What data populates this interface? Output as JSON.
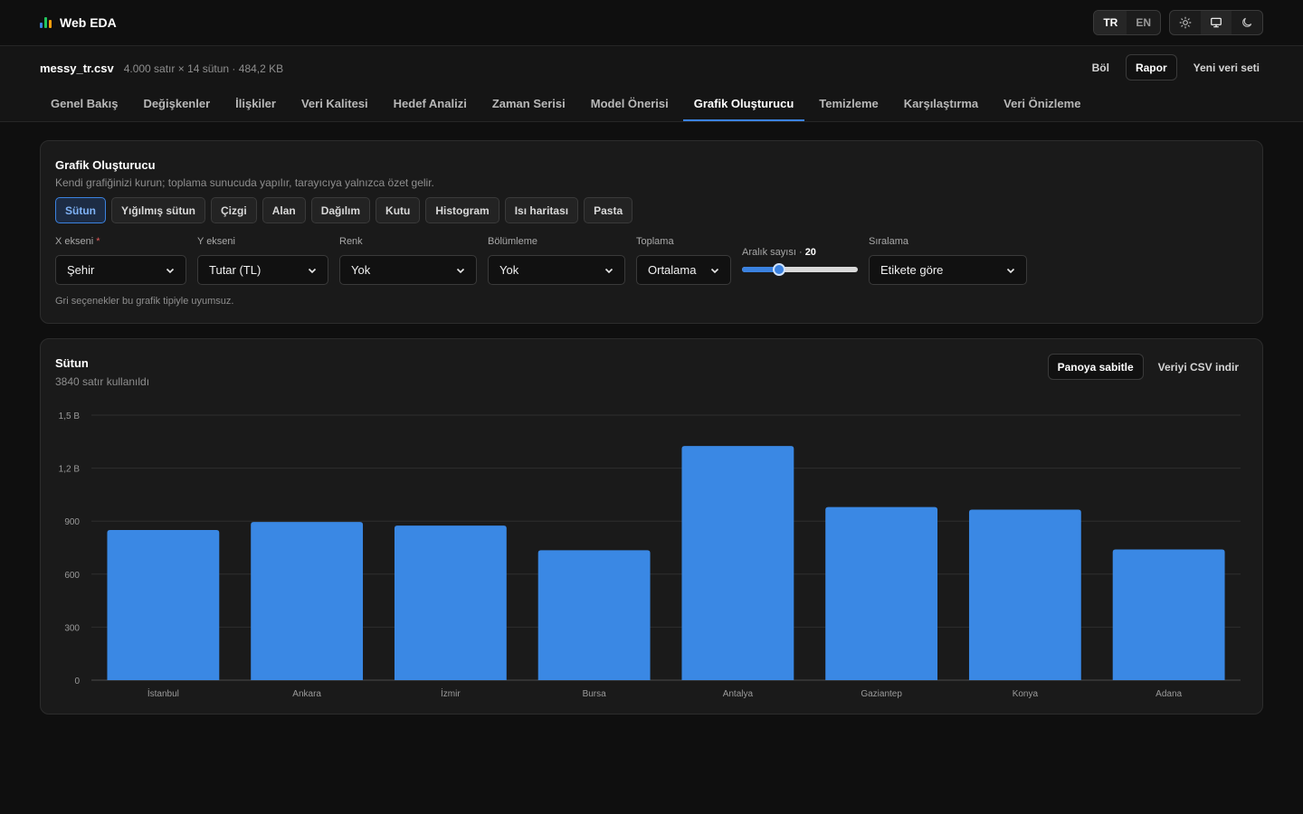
{
  "app": {
    "title": "Web EDA"
  },
  "lang": {
    "tr": "TR",
    "en": "EN",
    "active": "TR"
  },
  "file": {
    "name": "messy_tr.csv",
    "meta": "4.000 satır × 14 sütun · 484,2 KB",
    "actions": {
      "split": "Böl",
      "report": "Rapor",
      "new_dataset": "Yeni veri seti"
    }
  },
  "tabs": [
    {
      "label": "Genel Bakış"
    },
    {
      "label": "Değişkenler"
    },
    {
      "label": "İlişkiler"
    },
    {
      "label": "Veri Kalitesi"
    },
    {
      "label": "Hedef Analizi"
    },
    {
      "label": "Zaman Serisi"
    },
    {
      "label": "Model Önerisi"
    },
    {
      "label": "Grafik Oluşturucu",
      "active": true
    },
    {
      "label": "Temizleme"
    },
    {
      "label": "Karşılaştırma"
    },
    {
      "label": "Veri Önizleme"
    }
  ],
  "builder": {
    "title": "Grafik Oluşturucu",
    "subtitle": "Kendi grafiğinizi kurun; toplama sunucuda yapılır, tarayıcıya yalnızca özet gelir.",
    "types": [
      "Sütun",
      "Yığılmış sütun",
      "Çizgi",
      "Alan",
      "Dağılım",
      "Kutu",
      "Histogram",
      "Isı haritası",
      "Pasta"
    ],
    "active_type": "Sütun",
    "controls": {
      "x_axis": {
        "label": "X ekseni",
        "required": "*",
        "value": "Şehir"
      },
      "y_axis": {
        "label": "Y ekseni",
        "value": "Tutar (TL)"
      },
      "color": {
        "label": "Renk",
        "value": "Yok"
      },
      "facet": {
        "label": "Bölümleme",
        "value": "Yok"
      },
      "aggregation": {
        "label": "Toplama",
        "value": "Ortalama"
      },
      "bins": {
        "label": "Aralık sayısı · ",
        "value": "20",
        "fraction": 0.3
      },
      "sort": {
        "label": "Sıralama",
        "value": "Etikete göre"
      }
    },
    "note": "Gri seçenekler bu grafik tipiyle uyumsuz."
  },
  "chart_panel": {
    "title": "Sütun",
    "subtitle": "3840 satır kullanıldı",
    "pin_button": "Panoya sabitle",
    "download_button": "Veriyi CSV indir"
  },
  "colors": {
    "accent": "#3b82e0",
    "bar": "#3a88e4"
  },
  "chart_data": {
    "type": "bar",
    "categories": [
      "İstanbul",
      "Ankara",
      "İzmir",
      "Bursa",
      "Antalya",
      "Gaziantep",
      "Konya",
      "Adana"
    ],
    "values": [
      850000000,
      895000000,
      875000000,
      735000000,
      1325000000,
      980000000,
      965000000,
      740000000
    ],
    "ylim": [
      0,
      1500000000
    ],
    "yticks": [
      0,
      300000000,
      600000000,
      900000000,
      1200000000,
      1500000000
    ],
    "ytick_labels": [
      "0",
      "300",
      "600",
      "900",
      "1,2 B",
      "1,5 B"
    ],
    "title": "",
    "xlabel": "",
    "ylabel": "",
    "grid": true
  }
}
